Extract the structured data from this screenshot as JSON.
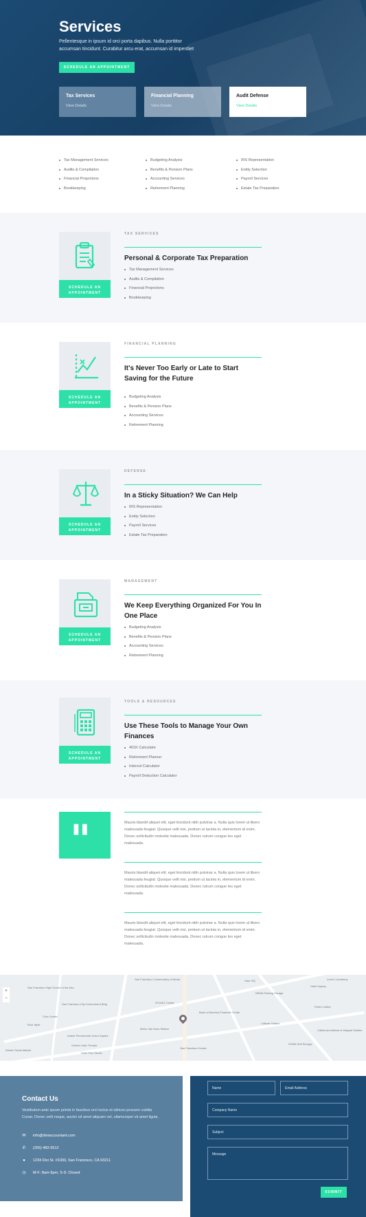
{
  "hero": {
    "title": "Services",
    "lead": "Pellentesque in ipsum id orci porta dapibus. Nulla porttitor accumsan tincidunt. Curabitur arcu erat, accumsan id imperdiet",
    "cta": "SCHEDULE AN APPOINTMENT",
    "cards": [
      {
        "title": "Tax Services",
        "link": "View Details"
      },
      {
        "title": "Financial Planning",
        "link": "View Details"
      },
      {
        "title": "Audit Defense",
        "link": "View Details"
      }
    ]
  },
  "service_list": {
    "col1": [
      "Tax Management Services",
      "Audits & Compilation",
      "Financial Projections",
      "Bookkeeping"
    ],
    "col2": [
      "Budgeting Analysis",
      "Benefits & Pension Plans",
      "Accounting Services",
      "Retirement Planning"
    ],
    "col3": [
      "IRS Representation",
      "Entity Selection",
      "Payroll Services",
      "Estate Tax Preparation"
    ]
  },
  "sections": [
    {
      "kicker": "TAX SERVICES",
      "title": "Personal & Corporate Tax Preparation",
      "button": "SCHEDULE AN APPOINTMENT",
      "icon": "clipboard-icon",
      "items": [
        "Tax Management Services",
        "Audits & Compilation",
        "Financial Projections",
        "Bookkeeping"
      ]
    },
    {
      "kicker": "FINANCIAL PLANNING",
      "title": "It's Never Too Early or Late to Start Saving for the Future",
      "button": "SCHEDULE AN APPOINTMENT",
      "icon": "chart-icon",
      "items": [
        "Budgeting Analysis",
        "Benefits & Pension Plans",
        "Accounting Services",
        "Retirement Planning"
      ]
    },
    {
      "kicker": "DEFENSE",
      "title": "In a Sticky Situation? We Can Help",
      "button": "SCHEDULE AN APPOINTMENT",
      "icon": "scales-icon",
      "items": [
        "IRS Representation",
        "Entity Selection",
        "Payroll Services",
        "Estate Tax Preparation"
      ]
    },
    {
      "kicker": "MANAGEMENT",
      "title": "We Keep Everything Organized For You In One Place",
      "button": "SCHEDULE AN APPOINTMENT",
      "icon": "file-cabinet-icon",
      "items": [
        "Budgeting Analysis",
        "Benefits & Pension Plans",
        "Accounting Services",
        "Retirement Planning"
      ]
    },
    {
      "kicker": "TOOLS & RESOURCES",
      "title": "Use These Tools to Manage Your Own Finances",
      "button": "SCHEDULE AN APPOINTMENT",
      "icon": "calculator-icon",
      "items": [
        "401K Calculator",
        "Retirement Planner",
        "Interest Calculator",
        "Payroll Deduction Calculator"
      ]
    }
  ],
  "testimonials": [
    "Mauris blandit aliquet elit, eget tincidunt nibh pulvinar a. Nulla quis lorem ut libero malesuada feugiat. Quisque velit nisi, pretium ut lacinia in, elementum id enim. Donec sollicitudin molestie malesuada. Donec rutrum congue leo eget malesuada.",
    "Mauris blandit aliquet elit, eget tincidunt nibh pulvinar a. Nulla quis lorem ut libero malesuada feugiat. Quisque velit nisi, pretium ut lacinia in, elementum id enim. Donec sollicitudin molestie malesuada. Donec rutrum congue leo eget malesuada.",
    "Mauris blandit aliquet elit, eget tincidunt nibh pulvinar a. Nulla quis lorem ut libero malesuada feugiat. Quisque velit nisi, pretium ut lacinia in, elementum id enim. Donec sollicitudin molestie malesuada. Donec rutrum congue leo eget malesuada."
  ],
  "map": {
    "labels": [
      "San Francisco Conservatory of Music",
      "Uber HQ",
      "Level 1 Academy",
      "Hotel Zephyr",
      "San Francisco High School of the Arts",
      "NEMA Parking Garage",
      "San Francisco City Government Bldg",
      "SFJAZZ Center",
      "Bank of America Financial Center",
      "Peet's Coffee",
      "Civic Center",
      "Rich Table",
      "Metro Van Ness Station",
      "Caltrain Station",
      "Kaiser Permanente Union Square",
      "Golden Gate Theatre",
      "Hotel Plus Studio",
      "Whole Foods Market",
      "San Francisco Honda",
      "SOMA Self Storage",
      "California Institute of Integral Studies"
    ],
    "zoom_in": "+",
    "zoom_out": "−"
  },
  "contact": {
    "title": "Contact Us",
    "desc": "Vestibulum ante ipsum primis in faucibus orci luctus et ultrices posuere cubilia Curae; Donec velit neque, auctor sit amet aliquam vel, ullamcorper sit amet ligula.",
    "email": "info@diviaccountant.com",
    "phone": "(255) 482-5512",
    "address": "1234 Divi St. #1000, San Francisco, CA 93211",
    "hours": "M-F: 8am-5pm, S-S: Closed",
    "form": {
      "name": "Name",
      "email": "Email Address",
      "company": "Company Name",
      "subject": "Subject",
      "message": "Message",
      "submit": "SUBMIT"
    }
  },
  "colors": {
    "accent": "#2de0a7",
    "navy": "#1b4a72",
    "slate": "#5a80a0",
    "alt_bg": "#f4f6fa"
  }
}
